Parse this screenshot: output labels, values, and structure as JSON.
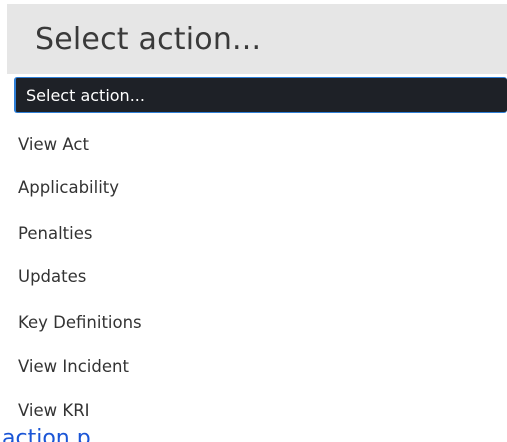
{
  "select": {
    "current_value": "Select action..."
  },
  "options": [
    {
      "label": "Select action...",
      "selected": true
    },
    {
      "label": "View Act",
      "selected": false
    },
    {
      "label": "Applicability",
      "selected": false
    },
    {
      "label": "Penalties",
      "selected": false
    },
    {
      "label": "Updates",
      "selected": false
    },
    {
      "label": "Key Definitions",
      "selected": false
    },
    {
      "label": "View Incident",
      "selected": false
    },
    {
      "label": "View KRI",
      "selected": false
    }
  ],
  "background_link": {
    "partial_text": "action p"
  },
  "colors": {
    "header_bg": "#e6e6e6",
    "selected_bg": "#1e2127",
    "selected_border": "#2f7fd6",
    "link": "#1a55d6"
  }
}
